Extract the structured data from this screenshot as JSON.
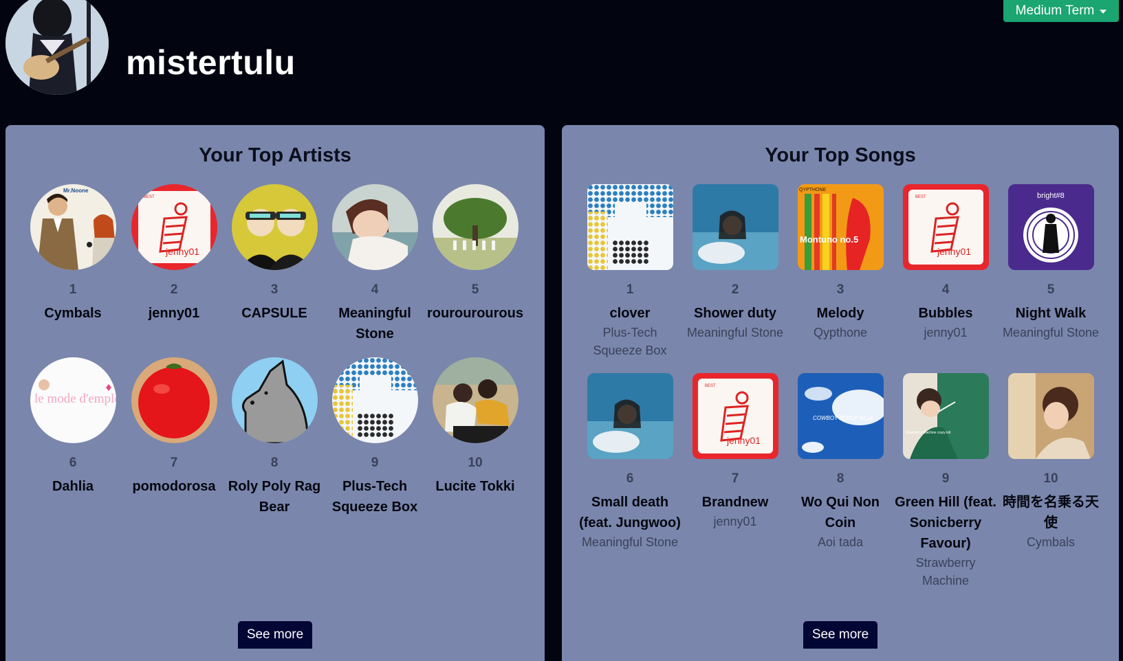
{
  "user": {
    "name": "mistertulu"
  },
  "term_selector": {
    "label": "Medium Term"
  },
  "artists_panel": {
    "title": "Your Top Artists",
    "see_more_label": "See more",
    "items": [
      {
        "rank": "1",
        "name": "Cymbals"
      },
      {
        "rank": "2",
        "name": "jenny01"
      },
      {
        "rank": "3",
        "name": "CAPSULE"
      },
      {
        "rank": "4",
        "name": "Meaningful Stone"
      },
      {
        "rank": "5",
        "name": "rourourourous"
      },
      {
        "rank": "6",
        "name": "Dahlia"
      },
      {
        "rank": "7",
        "name": "pomodorosa"
      },
      {
        "rank": "8",
        "name": "Roly Poly Rag Bear"
      },
      {
        "rank": "9",
        "name": "Plus-Tech Squeeze Box"
      },
      {
        "rank": "10",
        "name": "Lucite Tokki"
      }
    ]
  },
  "songs_panel": {
    "title": "Your Top Songs",
    "see_more_label": "See more",
    "items": [
      {
        "rank": "1",
        "title": "clover",
        "artist": "Plus-Tech Squeeze Box"
      },
      {
        "rank": "2",
        "title": "Shower duty",
        "artist": "Meaningful Stone"
      },
      {
        "rank": "3",
        "title": "Melody",
        "artist": "Qypthone"
      },
      {
        "rank": "4",
        "title": "Bubbles",
        "artist": "jenny01"
      },
      {
        "rank": "5",
        "title": "Night Walk",
        "artist": "Meaningful Stone"
      },
      {
        "rank": "6",
        "title": "Small death (feat. Jungwoo)",
        "artist": "Meaningful Stone"
      },
      {
        "rank": "7",
        "title": "Brandnew",
        "artist": "jenny01"
      },
      {
        "rank": "8",
        "title": "Wo Qui Non Coin",
        "artist": "Aoi tada"
      },
      {
        "rank": "9",
        "title": "Green Hill (feat. Sonicberry Favour)",
        "artist": "Strawberry Machine"
      },
      {
        "rank": "10",
        "title": "時間を名乗る天使",
        "artist": "Cymbals"
      }
    ]
  },
  "artwork_text": {
    "cymbals_cover": "Mr.Noone",
    "jenny_cover": "jenny01",
    "jenny_badge": "BEST",
    "dahlia_cover": "le mode d'emploi",
    "melody_cover": "Montuno no.5",
    "melody_header": "QYPTHONE",
    "nightwalk_cover": "bright#8",
    "wo_qui_cover": "COWBOY BEBOP BLUE",
    "green_hill_cover": "Strawberry Machine crazy kilt"
  }
}
